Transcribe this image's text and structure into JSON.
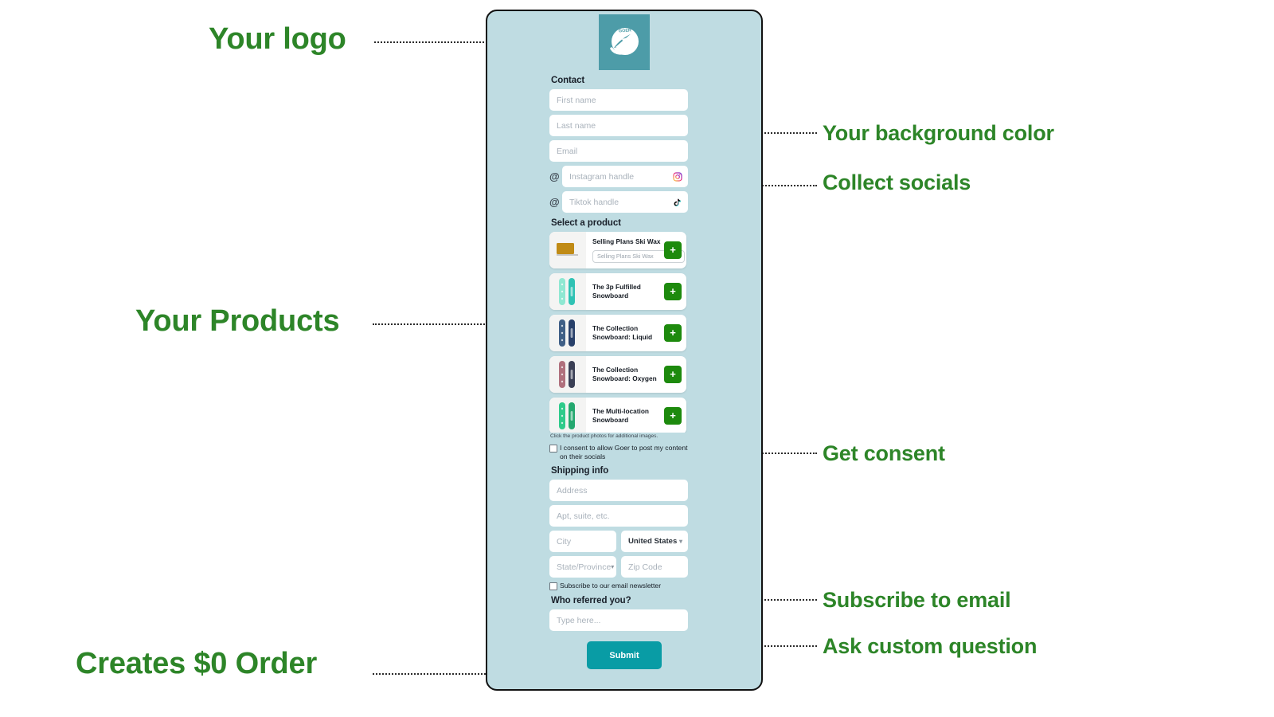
{
  "annotations": {
    "logo": "Your logo",
    "background_color": "Your background color",
    "socials": "Collect socials",
    "products": "Your Products",
    "consent": "Get consent",
    "subscribe": "Subscribe to email",
    "custom_question": "Ask custom question",
    "zero_order": "Creates $0 Order"
  },
  "colors": {
    "annotation_green": "#2d8528",
    "panel_background": "#bfdce2",
    "logo_teal": "#4d9ca8",
    "submit_teal": "#099ca5",
    "add_button_green": "#1d8a0d"
  },
  "form": {
    "logo": {
      "brand": "GOER",
      "icon": "airplane-logo-icon"
    },
    "contact": {
      "title": "Contact",
      "first_name_placeholder": "First name",
      "last_name_placeholder": "Last name",
      "email_placeholder": "Email",
      "instagram_placeholder": "Instagram handle",
      "tiktok_placeholder": "Tiktok handle",
      "at_symbol": "@"
    },
    "products": {
      "title": "Select a product",
      "hint": "Click the product photos for additional images.",
      "add_label": "+",
      "items": [
        {
          "name": "Selling Plans Ski Wax",
          "variant": "Selling Plans Ski Wax",
          "thumb_type": "ski-wax",
          "thumb_colors": [
            "#c08b16",
            "#e0e0de"
          ]
        },
        {
          "name": "The 3p Fulfilled Snowboard",
          "thumb_type": "snowboards",
          "thumb_colors": [
            "#8fe8d2",
            "#2fc2b4"
          ]
        },
        {
          "name": "The Collection Snowboard: Liquid",
          "thumb_type": "snowboards",
          "thumb_colors": [
            "#3f5f86",
            "#28406a"
          ]
        },
        {
          "name": "The Collection Snowboard: Oxygen",
          "thumb_type": "snowboards",
          "thumb_colors": [
            "#b0707d",
            "#3a3f55"
          ]
        },
        {
          "name": "The Multi-location Snowboard",
          "thumb_type": "snowboards",
          "thumb_colors": [
            "#2ecb8b",
            "#24a86f"
          ]
        }
      ]
    },
    "consent": {
      "label": "I consent to allow Goer to post my content on their socials",
      "checked": false
    },
    "shipping": {
      "title": "Shipping info",
      "address_placeholder": "Address",
      "apt_placeholder": "Apt, suite, etc.",
      "city_placeholder": "City",
      "country_value": "United States",
      "state_placeholder": "State/Province",
      "zip_placeholder": "Zip Code"
    },
    "newsletter": {
      "label": "Subscribe to our email newsletter",
      "checked": false
    },
    "referral": {
      "title": "Who referred you?",
      "placeholder": "Type here..."
    },
    "submit_label": "Submit"
  }
}
